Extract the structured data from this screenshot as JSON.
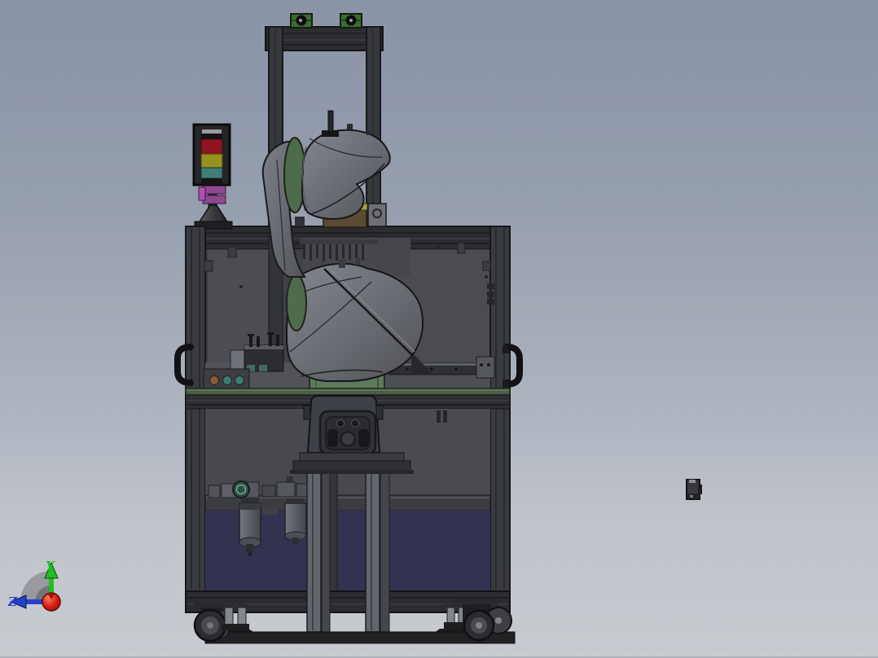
{
  "triad": {
    "y_label": "Y",
    "z_label": "Z",
    "y_color": "#1FBF1F",
    "z_color": "#2440CC",
    "origin_color": "#C01010"
  },
  "colors": {
    "bg_top": "#8A93A7",
    "bg_bottom": "#C8CBD0",
    "frame_dark": "#2B2C2F",
    "frame_post": "#3A3B3F",
    "panel_gray": "#47494E",
    "panel_interior": "#3F4145",
    "panel_blue": "#333250",
    "table_green": "#4A5E48",
    "joint_green": "#4E6B4C",
    "base_green": "#5D7A5A",
    "lift_green": "#3A6B33",
    "tower_red": "#8E1520",
    "tower_amber": "#97901F",
    "tower_teal": "#3F7E77",
    "tower_purple": "#8E4890",
    "tower_magenta": "#B050B2",
    "wood_brown": "#5C4B33",
    "handle_black": "#121214",
    "wheel_dark": "#2C2C30",
    "leg_gray": "#63656C"
  }
}
